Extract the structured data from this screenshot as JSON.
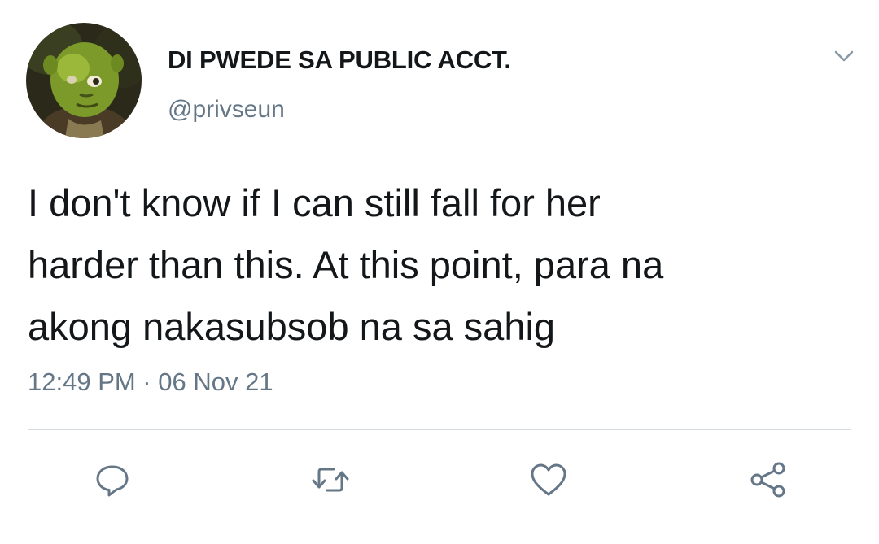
{
  "tweet": {
    "display_name": "DI PWEDE SA PUBLIC ACCT.",
    "handle": "@privseun",
    "text_lines": [
      "I don't know if I can still fall for her",
      "harder than this. At this point, para na",
      "akong nakasubsob na sa sahig"
    ],
    "timestamp": "12:49 PM · 06 Nov 21"
  },
  "icons": {
    "avatar": "avatar-image",
    "menu": "chevron-down-icon",
    "reply": "reply-icon",
    "retweet": "retweet-icon",
    "like": "heart-icon",
    "share": "share-icon"
  },
  "colors": {
    "text": "#14171a",
    "secondary": "#657786",
    "icon": "#657786",
    "divider": "#d7dde1",
    "background": "#ffffff"
  }
}
